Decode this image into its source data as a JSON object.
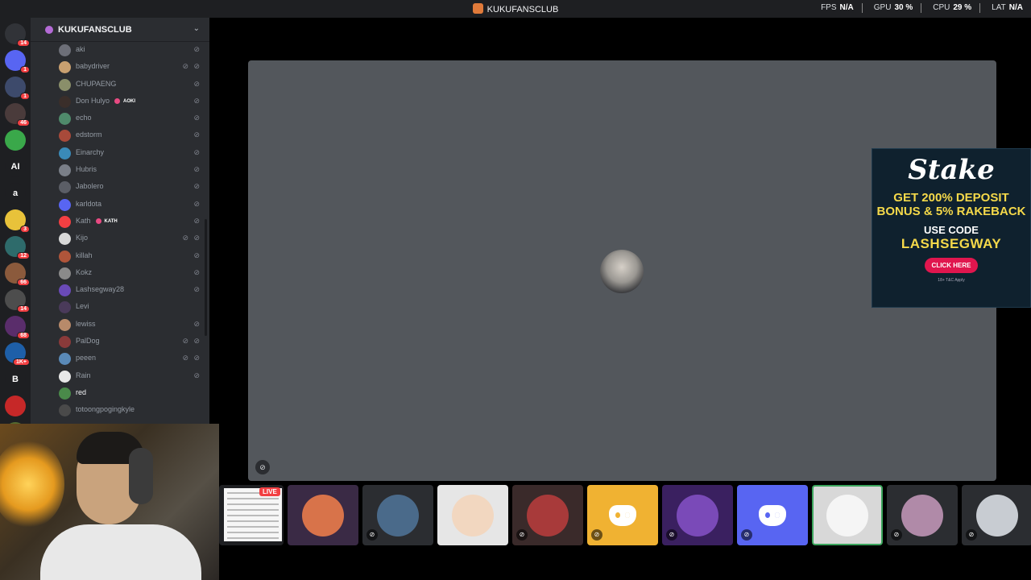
{
  "window": {
    "title": "KUKUFANSCLUB",
    "stats": [
      {
        "label": "FPS",
        "value": "N/A"
      },
      {
        "label": "GPU",
        "value": "30 %"
      },
      {
        "label": "CPU",
        "value": "29 %"
      },
      {
        "label": "LAT",
        "value": "N/A"
      }
    ]
  },
  "guilds": [
    {
      "icon": "discord-home-icon",
      "badge": "14",
      "color": "#313338",
      "text": ""
    },
    {
      "icon": "discord-server-icon",
      "badge": "1",
      "color": "#5865f2",
      "text": ""
    },
    {
      "icon": "server-avatar-icon",
      "badge": "1",
      "color": "#3d4a6b",
      "text": ""
    },
    {
      "icon": "server-avatar-icon",
      "badge": "46",
      "color": "#4a3b3b",
      "text": ""
    },
    {
      "icon": "pepe-server-icon",
      "badge": "",
      "color": "#3aa84a",
      "text": ""
    },
    {
      "icon": "ai-server-icon",
      "badge": "",
      "color": "#1e1f22",
      "text": "AI"
    },
    {
      "icon": "letter-server-icon",
      "badge": "",
      "color": "#1e1f22",
      "text": "a"
    },
    {
      "icon": "pikachu-server-icon",
      "badge": "3",
      "color": "#e8c23a",
      "text": ""
    },
    {
      "icon": "server-avatar-icon",
      "badge": "12",
      "color": "#2e6b6b",
      "text": ""
    },
    {
      "icon": "server-avatar-icon",
      "badge": "66",
      "color": "#8b5a3c",
      "text": ""
    },
    {
      "icon": "server-avatar-icon",
      "badge": "14",
      "color": "#4d4d4d",
      "text": ""
    },
    {
      "icon": "server-avatar-icon",
      "badge": "68",
      "color": "#5a2d6b",
      "text": ""
    },
    {
      "icon": "server-avatar-icon",
      "badge": "1K+",
      "color": "#1e5fa8",
      "text": ""
    },
    {
      "icon": "letter-server-icon",
      "badge": "",
      "color": "#1e1f22",
      "text": "B"
    },
    {
      "icon": "server-avatar-icon",
      "badge": "",
      "color": "#c62828",
      "text": ""
    },
    {
      "icon": "server-avatar-icon",
      "badge": "",
      "color": "#556b2f",
      "text": ""
    }
  ],
  "server": {
    "name": "KUKUFANSCLUB"
  },
  "members": [
    {
      "name": "aki",
      "color": "#6d6f78",
      "muted": true,
      "deafened": false,
      "tag": "",
      "bright": false
    },
    {
      "name": "babydriver",
      "color": "#c9a070",
      "muted": true,
      "deafened": true,
      "tag": "",
      "bright": false
    },
    {
      "name": "CHUPAENG",
      "color": "#8a8f6a",
      "muted": true,
      "deafened": false,
      "tag": "",
      "bright": false
    },
    {
      "name": "Don Hulyo",
      "color": "#3a2e2a",
      "muted": true,
      "deafened": false,
      "tag": "AOKI",
      "bright": false
    },
    {
      "name": "echo",
      "color": "#4f8a6b",
      "muted": true,
      "deafened": false,
      "tag": "",
      "bright": false
    },
    {
      "name": "edstorm",
      "color": "#a84a3a",
      "muted": true,
      "deafened": false,
      "tag": "",
      "bright": false
    },
    {
      "name": "Einarchy",
      "color": "#3a8ab8",
      "muted": true,
      "deafened": false,
      "tag": "",
      "bright": false
    },
    {
      "name": "Hubris",
      "color": "#7a7f88",
      "muted": true,
      "deafened": false,
      "tag": "",
      "bright": false
    },
    {
      "name": "Jabolero",
      "color": "#5b5e66",
      "muted": true,
      "deafened": false,
      "tag": "",
      "bright": false
    },
    {
      "name": "karldota",
      "color": "#5865f2",
      "muted": true,
      "deafened": false,
      "tag": "",
      "bright": false
    },
    {
      "name": "Kath",
      "color": "#f23f42",
      "muted": true,
      "deafened": false,
      "tag": "KATH",
      "bright": false
    },
    {
      "name": "Kijo",
      "color": "#d8d8d8",
      "muted": true,
      "deafened": true,
      "tag": "",
      "bright": false
    },
    {
      "name": "killah",
      "color": "#b0553a",
      "muted": true,
      "deafened": false,
      "tag": "",
      "bright": false
    },
    {
      "name": "Kokz",
      "color": "#8a8a8a",
      "muted": true,
      "deafened": false,
      "tag": "",
      "bright": false
    },
    {
      "name": "Lashsegway28",
      "color": "#6a4ab8",
      "muted": true,
      "deafened": false,
      "tag": "",
      "bright": false
    },
    {
      "name": "Levi",
      "color": "#4a3a5a",
      "muted": false,
      "deafened": false,
      "tag": "",
      "bright": false
    },
    {
      "name": "lewiss",
      "color": "#b88a6a",
      "muted": true,
      "deafened": false,
      "tag": "",
      "bright": false
    },
    {
      "name": "PalDog",
      "color": "#8a3a3a",
      "muted": true,
      "deafened": true,
      "tag": "",
      "bright": false
    },
    {
      "name": "peeen",
      "color": "#5a8ab8",
      "muted": true,
      "deafened": true,
      "tag": "",
      "bright": false
    },
    {
      "name": "Rain",
      "color": "#e8e8e8",
      "muted": true,
      "deafened": false,
      "tag": "",
      "bright": false
    },
    {
      "name": "red",
      "color": "#4a8a4a",
      "muted": false,
      "deafened": false,
      "tag": "",
      "bright": true
    },
    {
      "name": "totoongpogingkyle",
      "color": "#4a4a4a",
      "muted": false,
      "deafened": false,
      "tag": "",
      "bright": false
    }
  ],
  "ad": {
    "brand": "Stake",
    "offer": "GET 200% DEPOSIT BONUS & 5% RAKEBACK",
    "use_code": "USE CODE",
    "code": "LASHSEGWAY",
    "button": "CLICK HERE",
    "fine": "18+ T&C Apply"
  },
  "stream_strip": {
    "live_badge": "LIVE",
    "tiles": [
      {
        "kind": "stream",
        "bg": "#1e1f22",
        "muted": false,
        "live": true
      },
      {
        "kind": "avatar",
        "bg": "#3a2a45",
        "color": "#d8734a",
        "muted": false
      },
      {
        "kind": "avatar",
        "bg": "#2b2d31",
        "color": "#4a6a8a",
        "muted": true
      },
      {
        "kind": "avatar",
        "bg": "#e6e6e6",
        "color": "#f2d7c0",
        "muted": false
      },
      {
        "kind": "avatar",
        "bg": "#3a2a2a",
        "color": "#a83a3a",
        "muted": true
      },
      {
        "kind": "discord",
        "bg": "#f0b232",
        "muted": true
      },
      {
        "kind": "avatar",
        "bg": "#3a2060",
        "color": "#7a4ab8",
        "muted": true
      },
      {
        "kind": "discord",
        "bg": "#5865f2",
        "muted": true
      },
      {
        "kind": "avatar",
        "bg": "#d8d8d8",
        "color": "#f5f5f5",
        "muted": false,
        "selected": true
      },
      {
        "kind": "avatar",
        "bg": "#2b2d31",
        "color": "#b08aa8",
        "muted": true
      },
      {
        "kind": "avatar",
        "bg": "#2b2d31",
        "color": "#c8ccd2",
        "muted": true
      }
    ]
  }
}
